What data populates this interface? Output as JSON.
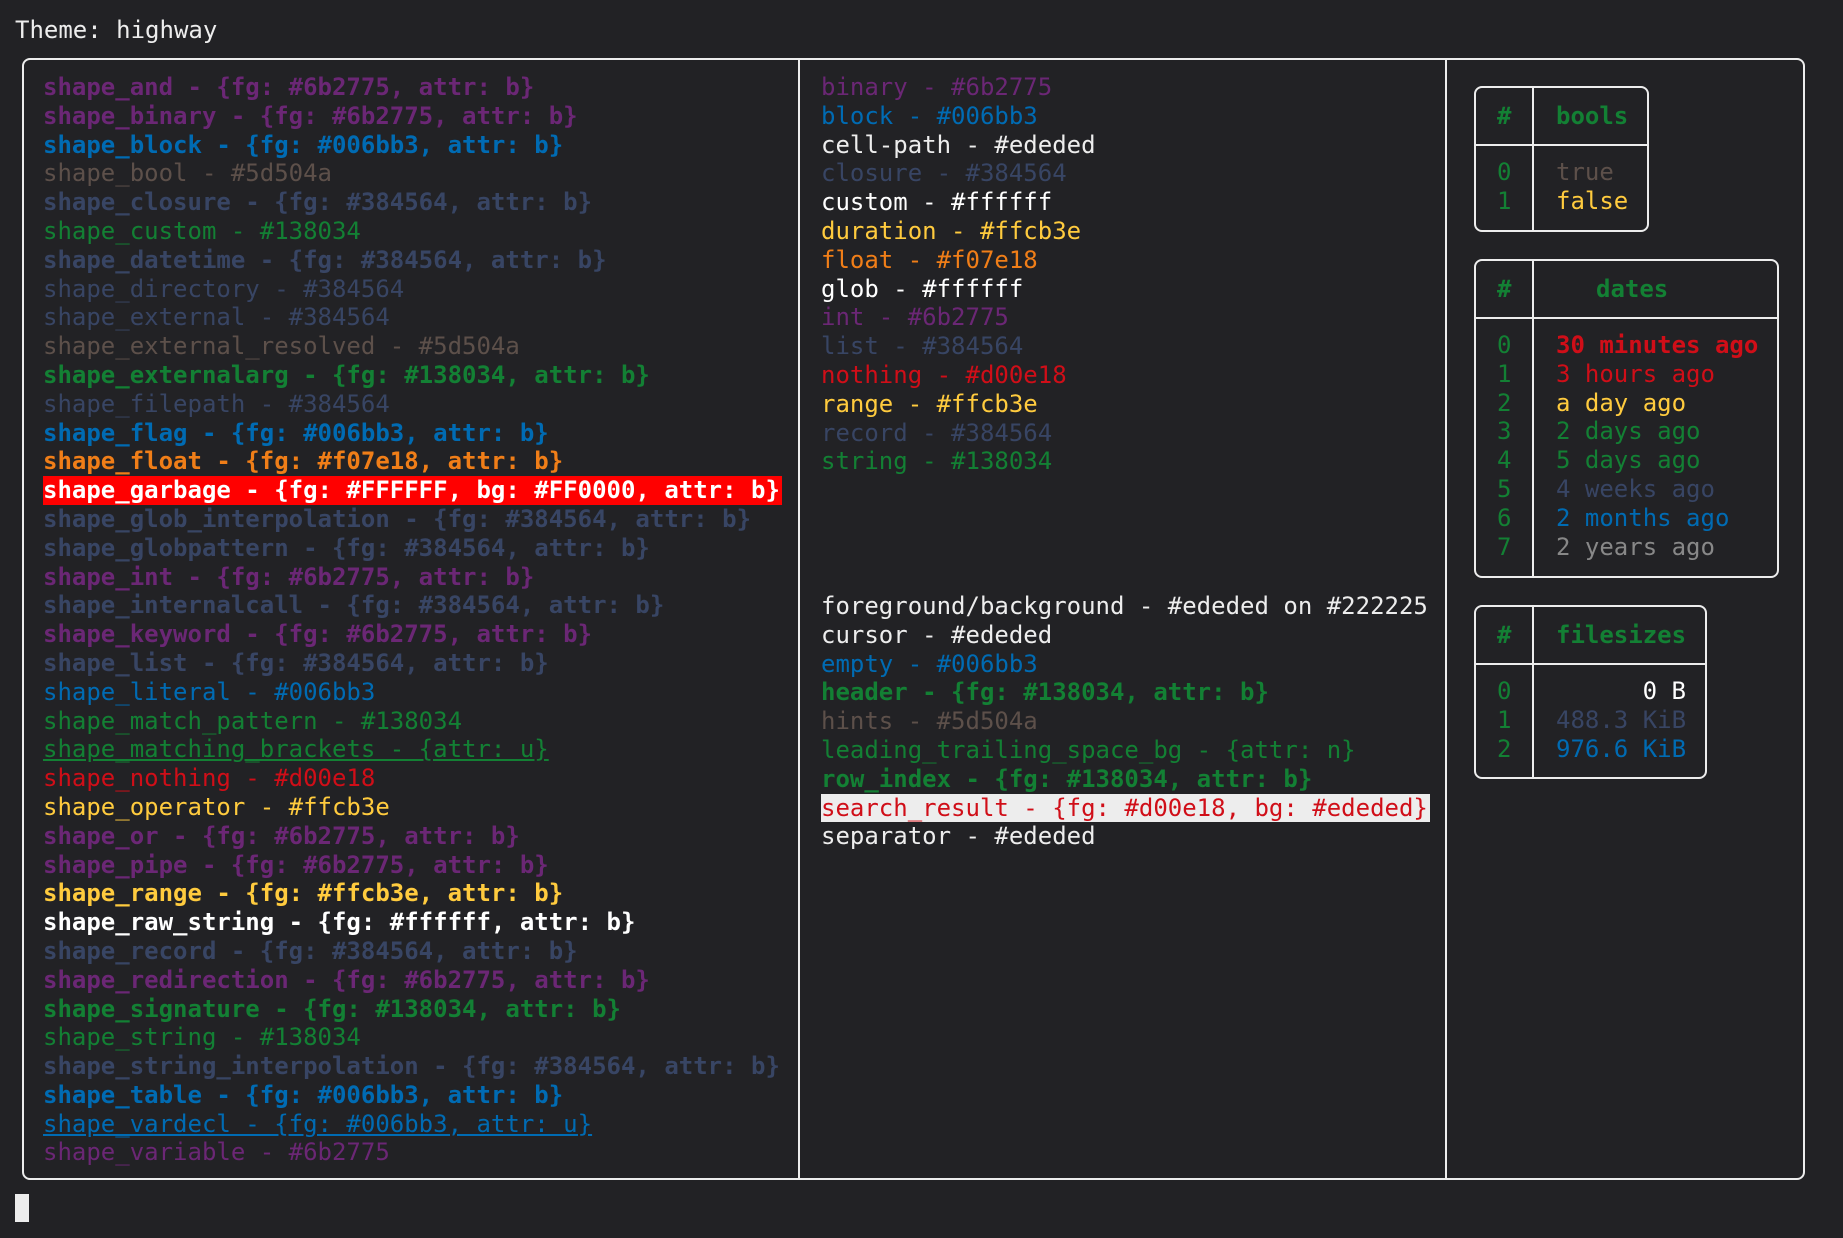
{
  "title": "Theme: highway",
  "shapes": [
    {
      "text": "shape_and - {fg: #6b2775, attr: b}",
      "color": "#6b2775",
      "bold": true
    },
    {
      "text": "shape_binary - {fg: #6b2775, attr: b}",
      "color": "#6b2775",
      "bold": true
    },
    {
      "text": "shape_block - {fg: #006bb3, attr: b}",
      "color": "#006bb3",
      "bold": true
    },
    {
      "text": "shape_bool - #5d504a",
      "color": "#5d504a"
    },
    {
      "text": "shape_closure - {fg: #384564, attr: b}",
      "color": "#384564",
      "bold": true
    },
    {
      "text": "shape_custom - #138034",
      "color": "#138034"
    },
    {
      "text": "shape_datetime - {fg: #384564, attr: b}",
      "color": "#384564",
      "bold": true
    },
    {
      "text": "shape_directory - #384564",
      "color": "#384564"
    },
    {
      "text": "shape_external - #384564",
      "color": "#384564"
    },
    {
      "text": "shape_external_resolved - #5d504a",
      "color": "#5d504a"
    },
    {
      "text": "shape_externalarg - {fg: #138034, attr: b}",
      "color": "#138034",
      "bold": true
    },
    {
      "text": "shape_filepath - #384564",
      "color": "#384564"
    },
    {
      "text": "shape_flag - {fg: #006bb3, attr: b}",
      "color": "#006bb3",
      "bold": true
    },
    {
      "text": "shape_float - {fg: #f07e18, attr: b}",
      "color": "#f07e18",
      "bold": true
    },
    {
      "text": "shape_garbage - {fg: #FFFFFF, bg: #FF0000, attr: b}",
      "color": "#FFFFFF",
      "bg": "#FF0000",
      "bold": true
    },
    {
      "text": "shape_glob_interpolation - {fg: #384564, attr: b}",
      "color": "#384564",
      "bold": true
    },
    {
      "text": "shape_globpattern - {fg: #384564, attr: b}",
      "color": "#384564",
      "bold": true
    },
    {
      "text": "shape_int - {fg: #6b2775, attr: b}",
      "color": "#6b2775",
      "bold": true
    },
    {
      "text": "shape_internalcall - {fg: #384564, attr: b}",
      "color": "#384564",
      "bold": true
    },
    {
      "text": "shape_keyword - {fg: #6b2775, attr: b}",
      "color": "#6b2775",
      "bold": true
    },
    {
      "text": "shape_list - {fg: #384564, attr: b}",
      "color": "#384564",
      "bold": true
    },
    {
      "text": "shape_literal - #006bb3",
      "color": "#006bb3"
    },
    {
      "text": "shape_match_pattern - #138034",
      "color": "#138034"
    },
    {
      "text": "shape_matching_brackets - {attr: u}",
      "color": "#138034",
      "underline": true
    },
    {
      "text": "shape_nothing - #d00e18",
      "color": "#d00e18"
    },
    {
      "text": "shape_operator - #ffcb3e",
      "color": "#ffcb3e"
    },
    {
      "text": "shape_or - {fg: #6b2775, attr: b}",
      "color": "#6b2775",
      "bold": true
    },
    {
      "text": "shape_pipe - {fg: #6b2775, attr: b}",
      "color": "#6b2775",
      "bold": true
    },
    {
      "text": "shape_range - {fg: #ffcb3e, attr: b}",
      "color": "#ffcb3e",
      "bold": true
    },
    {
      "text": "shape_raw_string - {fg: #ffffff, attr: b}",
      "color": "#ffffff",
      "bold": true
    },
    {
      "text": "shape_record - {fg: #384564, attr: b}",
      "color": "#384564",
      "bold": true
    },
    {
      "text": "shape_redirection - {fg: #6b2775, attr: b}",
      "color": "#6b2775",
      "bold": true
    },
    {
      "text": "shape_signature - {fg: #138034, attr: b}",
      "color": "#138034",
      "bold": true
    },
    {
      "text": "shape_string - #138034",
      "color": "#138034"
    },
    {
      "text": "shape_string_interpolation - {fg: #384564, attr: b}",
      "color": "#384564",
      "bold": true
    },
    {
      "text": "shape_table - {fg: #006bb3, attr: b}",
      "color": "#006bb3",
      "bold": true
    },
    {
      "text": "shape_vardecl - {fg: #006bb3, attr: u}",
      "color": "#006bb3",
      "underline": true
    },
    {
      "text": "shape_variable - #6b2775",
      "color": "#6b2775"
    }
  ],
  "types": [
    {
      "text": "binary - #6b2775",
      "color": "#6b2775"
    },
    {
      "text": "block - #006bb3",
      "color": "#006bb3"
    },
    {
      "text": "cell-path - #ededed",
      "color": "#ededed"
    },
    {
      "text": "closure - #384564",
      "color": "#384564"
    },
    {
      "text": "custom - #ffffff",
      "color": "#ffffff"
    },
    {
      "text": "duration - #ffcb3e",
      "color": "#ffcb3e"
    },
    {
      "text": "float - #f07e18",
      "color": "#f07e18"
    },
    {
      "text": "glob - #ffffff",
      "color": "#ffffff"
    },
    {
      "text": "int - #6b2775",
      "color": "#6b2775"
    },
    {
      "text": "list - #384564",
      "color": "#384564"
    },
    {
      "text": "nothing - #d00e18",
      "color": "#d00e18"
    },
    {
      "text": "range - #ffcb3e",
      "color": "#ffcb3e"
    },
    {
      "text": "record - #384564",
      "color": "#384564"
    },
    {
      "text": "string - #138034",
      "color": "#138034"
    }
  ],
  "ui": [
    {
      "text": "foreground/background - #ededed on #222225",
      "color": "#ededed"
    },
    {
      "text": "cursor - #ededed",
      "color": "#ededed"
    },
    {
      "text": "empty - #006bb3",
      "color": "#006bb3"
    },
    {
      "text": "header - {fg: #138034, attr: b}",
      "color": "#138034",
      "bold": true
    },
    {
      "text": "hints - #5d504a",
      "color": "#5d504a"
    },
    {
      "text": "leading_trailing_space_bg - {attr: n}",
      "color": "#138034"
    },
    {
      "text": "row_index - {fg: #138034, attr: b}",
      "color": "#138034",
      "bold": true
    },
    {
      "text": "search_result - {fg: #d00e18, bg: #ededed}",
      "color": "#d00e18",
      "bg": "#ededed"
    },
    {
      "text": "separator - #ededed",
      "color": "#ededed"
    }
  ],
  "bools": {
    "index_header": "#",
    "header": "bools",
    "rows": [
      {
        "index": "0",
        "value": "true",
        "color": "#5d504a"
      },
      {
        "index": "1",
        "value": "false",
        "color": "#ffcb3e"
      }
    ]
  },
  "dates": {
    "index_header": "#",
    "header": "dates",
    "rows": [
      {
        "index": "0",
        "value": "30 minutes ago",
        "color": "#d00e18",
        "bold": true
      },
      {
        "index": "1",
        "value": "3 hours ago",
        "color": "#d00e18"
      },
      {
        "index": "2",
        "value": "a day ago",
        "color": "#ffcb3e"
      },
      {
        "index": "3",
        "value": "2 days ago",
        "color": "#138034"
      },
      {
        "index": "4",
        "value": "5 days ago",
        "color": "#138034"
      },
      {
        "index": "5",
        "value": "4 weeks ago",
        "color": "#384564"
      },
      {
        "index": "6",
        "value": "2 months ago",
        "color": "#006bb3"
      },
      {
        "index": "7",
        "value": "2 years ago",
        "color": "#888888"
      }
    ]
  },
  "filesizes": {
    "index_header": "#",
    "header": "filesizes",
    "rows": [
      {
        "index": "0",
        "value": "0 B",
        "color": "#ffffff"
      },
      {
        "index": "1",
        "value": "488.3 KiB",
        "color": "#384564"
      },
      {
        "index": "2",
        "value": "976.6 KiB",
        "color": "#006bb3"
      }
    ]
  },
  "colors": {
    "background": "#222225",
    "foreground": "#ededed",
    "header": "#138034",
    "row_index": "#138034"
  }
}
